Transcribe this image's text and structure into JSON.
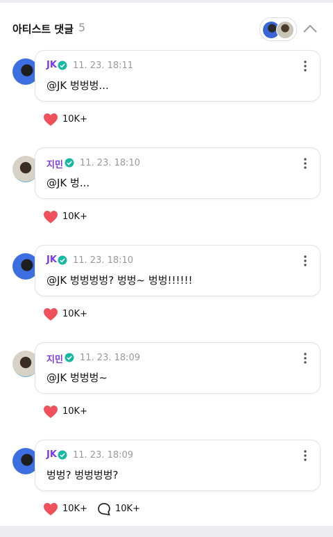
{
  "header": {
    "title": "아티스트 댓글",
    "count": "5"
  },
  "colors": {
    "author": "#7a3be0",
    "verified": "#19b8a5",
    "like": "#f0505a"
  },
  "comments": [
    {
      "author": "JK",
      "time": "11. 23. 18:11",
      "text": "@JK 벙벙벙...",
      "likes": "10K+",
      "replies": ""
    },
    {
      "author": "지민",
      "time": "11. 23. 18:10",
      "text": "@JK 벙...",
      "likes": "10K+",
      "replies": ""
    },
    {
      "author": "JK",
      "time": "11. 23. 18:10",
      "text": "@JK 벙벙벙벙? 벙벙~ 벙벙!!!!!!",
      "likes": "10K+",
      "replies": ""
    },
    {
      "author": "지민",
      "time": "11. 23. 18:09",
      "text": "@JK 벙벙벙~",
      "likes": "10K+",
      "replies": ""
    },
    {
      "author": "JK",
      "time": "11. 23. 18:09",
      "text": "벙벙? 벙벙벙벙?",
      "likes": "10K+",
      "replies": "10K+"
    }
  ]
}
